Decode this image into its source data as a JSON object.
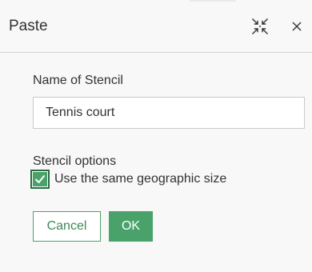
{
  "dialog": {
    "title": "Paste",
    "collapse_icon": "collapse-arrows-icon",
    "close_icon": "close-icon"
  },
  "form": {
    "name_label": "Name of Stencil",
    "name_value": "Tennis court",
    "options_label": "Stencil options",
    "same_size_checkbox": {
      "label": "Use the same geographic size",
      "checked": true
    }
  },
  "actions": {
    "cancel_label": "Cancel",
    "ok_label": "OK"
  },
  "colors": {
    "accent": "#4aa26b",
    "accent_dark": "#2b6b44",
    "background": "#f8f8f8",
    "text": "#323232"
  }
}
